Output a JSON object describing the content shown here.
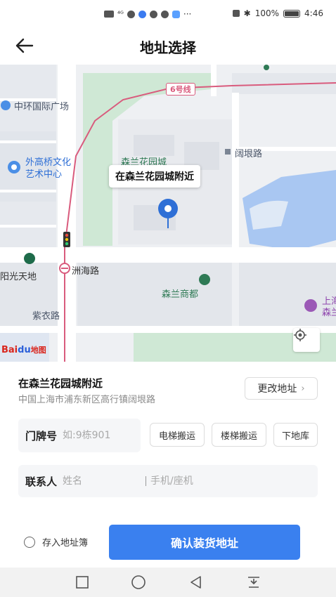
{
  "status_bar": {
    "signal": "⁴ᴳ",
    "more": "···",
    "battery_pct": "100%",
    "time": "4:46"
  },
  "header": {
    "title": "地址选择"
  },
  "map": {
    "callout": "在森兰花园城附近",
    "line_label": "6号线",
    "labels": {
      "zhonghuan": "中环国际广场",
      "waigaoqiao_1": "外高桥文化",
      "waigaoqiao_2": "艺术中心",
      "senlan_garden": "森兰花园城",
      "kuogen": "阔垠路",
      "zhouhai": "洲海路",
      "yangguang": "阳光天地",
      "senlan_shangdu": "森兰商都",
      "ziyi": "紫衣路",
      "shang": "上海",
      "sen": "森兰"
    },
    "logo_text": "Bai",
    "logo_paw": "du",
    "logo_sub": "地图"
  },
  "address": {
    "title": "在森兰花园城附近",
    "detail": "中国上海市浦东新区高行镇阔垠路",
    "change_label": "更改地址"
  },
  "door": {
    "label": "门牌号",
    "placeholder": "如:9栋901"
  },
  "chips": [
    "电梯搬运",
    "楼梯搬运",
    "下地库"
  ],
  "contact": {
    "label": "联系人",
    "name_placeholder": "姓名",
    "phone_placeholder": "手机/座机"
  },
  "footer": {
    "save_label": "存入地址簿",
    "confirm_label": "确认装货地址"
  },
  "colors": {
    "accent": "#3a80ef",
    "park": "#cfe8d5",
    "water": "#a9c7f2",
    "metro": "#d95b7d"
  }
}
